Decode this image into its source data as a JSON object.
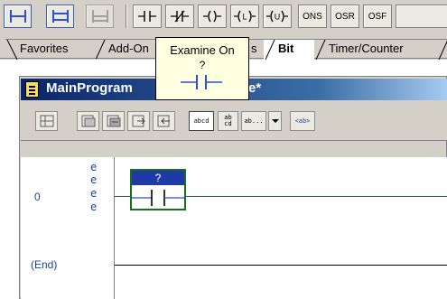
{
  "toolbar": {
    "buttons": [
      {
        "name": "rung-button",
        "icon": "rung-icon",
        "label": ""
      },
      {
        "name": "branch-button",
        "icon": "branch-icon",
        "label": ""
      },
      {
        "name": "branch-level-button",
        "icon": "branch-level-icon",
        "label": ""
      },
      {
        "name": "xic-button",
        "icon": "examine-on-icon",
        "label": ""
      },
      {
        "name": "xio-button",
        "icon": "examine-off-icon",
        "label": ""
      },
      {
        "name": "ote-button",
        "icon": "output-energize-icon",
        "label": ""
      },
      {
        "name": "otl-button",
        "icon": "output-latch-icon",
        "label": ""
      },
      {
        "name": "otu-button",
        "icon": "output-unlatch-icon",
        "label": ""
      },
      {
        "name": "ons-button",
        "icon": "",
        "label": "ONS"
      },
      {
        "name": "osr-button",
        "icon": "",
        "label": "OSR"
      },
      {
        "name": "osf-button",
        "icon": "",
        "label": "OSF"
      }
    ],
    "colors": {
      "blue_icon": "#2a4fd8",
      "grey_icon": "#808080"
    }
  },
  "tabs": [
    {
      "label": "Favorites",
      "active": false
    },
    {
      "label": "Add-On",
      "active": false
    },
    {
      "label": "s",
      "active": false
    },
    {
      "label": "Bit",
      "active": true
    },
    {
      "label": "Timer/Counter",
      "active": false
    }
  ],
  "tooltip": {
    "title": "Examine On",
    "tag": "?",
    "icon": "examine-on-icon"
  },
  "window": {
    "title": "MainProgram",
    "title_tail": "e*",
    "icon": "routine-icon"
  },
  "routine_toolbar": {
    "buttons": [
      {
        "name": "rung-props-button",
        "icon": "rung-props-icon",
        "label": ""
      },
      {
        "name": "verify-button",
        "icon": "verify-icon",
        "label": ""
      },
      {
        "name": "verify-all-button",
        "icon": "verify-all-icon",
        "label": ""
      },
      {
        "name": "export-button",
        "icon": "export-icon",
        "label": ""
      },
      {
        "name": "import-button",
        "icon": "import-icon",
        "label": ""
      },
      {
        "name": "abcd-button",
        "icon": "",
        "label": "abcd"
      },
      {
        "name": "ab-cd-button",
        "icon": "",
        "label": "ab cd"
      },
      {
        "name": "ab-more-button",
        "icon": "",
        "label": "ab..."
      },
      {
        "name": "dropdown-button",
        "icon": "chevron-down-icon",
        "label": ""
      },
      {
        "name": "ab-tag-button",
        "icon": "",
        "label": "<ab>"
      }
    ]
  },
  "ladder": {
    "rungs": [
      {
        "number": "0",
        "edit_marks": [
          "e",
          "e",
          "e",
          "e"
        ]
      },
      {
        "number": "(End)",
        "edit_marks": []
      }
    ],
    "instruction": {
      "tag": "?",
      "type": "examine-on-icon"
    },
    "colors": {
      "rung": "#2050c8",
      "selection": "#1d6b1d",
      "tag_bg": "#1e3aa8"
    }
  }
}
